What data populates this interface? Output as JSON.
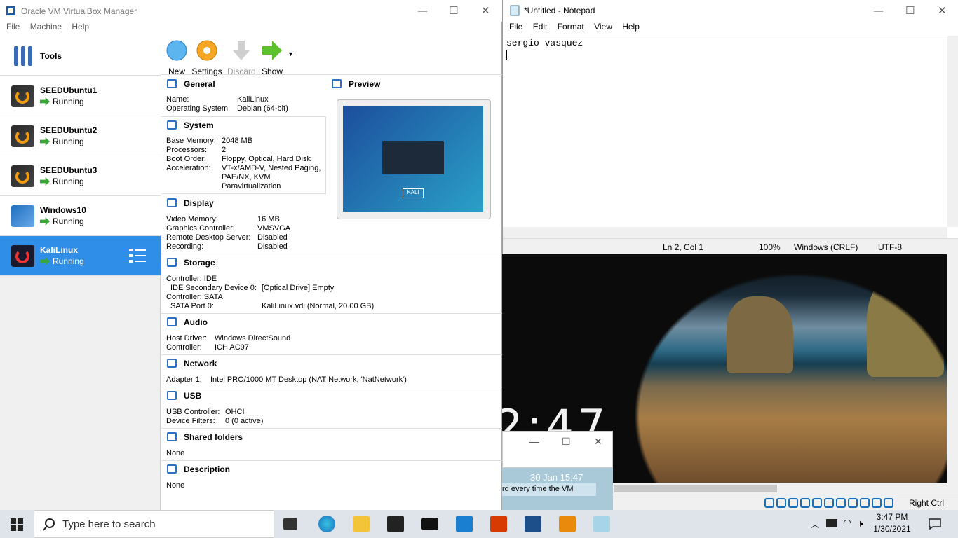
{
  "virtualbox": {
    "title": "Oracle VM VirtualBox Manager",
    "menu": [
      "File",
      "Machine",
      "Help"
    ],
    "tools_label": "Tools",
    "machines": [
      {
        "name": "SEEDUbuntu1",
        "state": "Running"
      },
      {
        "name": "SEEDUbuntu2",
        "state": "Running"
      },
      {
        "name": "SEEDUbuntu3",
        "state": "Running"
      },
      {
        "name": "Windows10",
        "state": "Running"
      },
      {
        "name": "KaliLinux",
        "state": "Running"
      }
    ],
    "toolbar": {
      "new": "New",
      "settings": "Settings",
      "discard": "Discard",
      "show": "Show"
    },
    "general": {
      "title": "General",
      "name_label": "Name:",
      "name": "KaliLinux",
      "os_label": "Operating System:",
      "os": "Debian (64-bit)"
    },
    "system": {
      "title": "System",
      "mem_label": "Base Memory:",
      "mem": "2048 MB",
      "proc_label": "Processors:",
      "proc": "2",
      "boot_label": "Boot Order:",
      "boot": "Floppy, Optical, Hard Disk",
      "accel_label": "Acceleration:",
      "accel1": "VT-x/AMD-V, Nested Paging,",
      "accel2": "PAE/NX, KVM",
      "accel3": "Paravirtualization"
    },
    "preview": {
      "title": "Preview",
      "kali": "KALI"
    },
    "display": {
      "title": "Display",
      "vmem_label": "Video Memory:",
      "vmem": "16 MB",
      "gc_label": "Graphics Controller:",
      "gc": "VMSVGA",
      "rds_label": "Remote Desktop Server:",
      "rds": "Disabled",
      "rec_label": "Recording:",
      "rec": "Disabled"
    },
    "storage": {
      "title": "Storage",
      "c1": "Controller: IDE",
      "ide_label": "IDE Secondary Device 0:",
      "ide": "[Optical Drive] Empty",
      "c2": "Controller: SATA",
      "sata_label": "SATA Port 0:",
      "sata": "KaliLinux.vdi (Normal, 20.00 GB)"
    },
    "audio": {
      "title": "Audio",
      "hd_label": "Host Driver:",
      "hd": "Windows DirectSound",
      "ctl_label": "Controller:",
      "ctl": "ICH AC97"
    },
    "network": {
      "title": "Network",
      "a1_label": "Adapter 1:",
      "a1": "Intel PRO/1000 MT Desktop (NAT Network, 'NatNetwork')"
    },
    "usb": {
      "title": "USB",
      "uc_label": "USB Controller:",
      "uc": "OHCI",
      "df_label": "Device Filters:",
      "df": "0 (0 active)"
    },
    "shared": {
      "title": "Shared folders",
      "value": "None"
    },
    "description": {
      "title": "Description",
      "value": "None"
    }
  },
  "notepad": {
    "title": "*Untitled - Notepad",
    "menu": [
      "File",
      "Edit",
      "Format",
      "View",
      "Help"
    ],
    "text": "sergio vasquez",
    "status": {
      "pos": "Ln 2, Col 1",
      "zoom": "100%",
      "eol": "Windows (CRLF)",
      "enc": "UTF-8"
    }
  },
  "vm_display": {
    "clock": "2:47",
    "mini_date": "30 Jan 15:47",
    "mini_tip": "rd every time the VM",
    "host_key": "Right Ctrl"
  },
  "taskbar": {
    "search_placeholder": "Type here to search",
    "time": "3:47 PM",
    "date": "1/30/2021"
  }
}
